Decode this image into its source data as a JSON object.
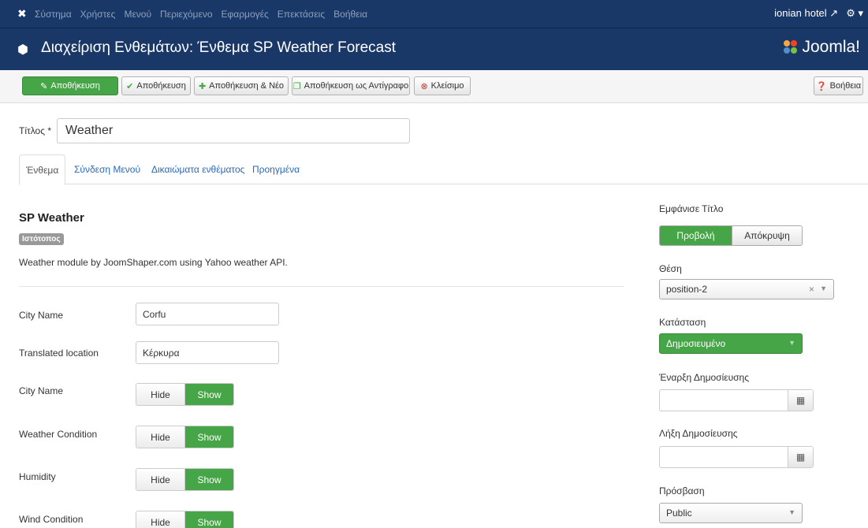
{
  "topnav": {
    "menu": [
      "Σύστημα",
      "Χρήστες",
      "Μενού",
      "Περιεχόμενο",
      "Εφαρμογές",
      "Επεκτάσεις",
      "Βοήθεια"
    ],
    "user": "ionian hotel"
  },
  "header": {
    "title": "Διαχείριση Ενθεμάτων: Ένθεμα SP Weather Forecast",
    "brand": "Joomla!"
  },
  "toolbar": {
    "save": "Αποθήκευση",
    "save_close": "Αποθήκευση",
    "save_new": "Αποθήκευση & Νέο",
    "save_copy": "Αποθήκευση ως Αντίγραφο",
    "close": "Κλείσιμο",
    "help": "Βοήθεια"
  },
  "form": {
    "title_label": "Τίτλος *",
    "title_value": "Weather"
  },
  "tabs": [
    "Ένθεμα",
    "Σύνδεση Μενού",
    "Δικαιώματα ενθέματος",
    "Προηγμένα"
  ],
  "module": {
    "name": "SP Weather",
    "badge": "Ιστότοπος",
    "description": "Weather module by JoomShaper.com using Yahoo weather API."
  },
  "fields": {
    "city_name_label": "City Name",
    "city_name_value": "Corfu",
    "translated_label": "Translated location",
    "translated_value": "Κέρκυρα"
  },
  "toggles": [
    {
      "label": "City Name",
      "off": "Hide",
      "on": "Show"
    },
    {
      "label": "Weather Condition",
      "off": "Hide",
      "on": "Show"
    },
    {
      "label": "Humidity",
      "off": "Hide",
      "on": "Show"
    },
    {
      "label": "Wind Condition",
      "off": "Hide",
      "on": "Show"
    }
  ],
  "sidebar": {
    "show_title_label": "Εμφάνισε Τίτλο",
    "show": "Προβολή",
    "hide": "Απόκρυψη",
    "position_label": "Θέση",
    "position_value": "position-2",
    "status_label": "Κατάσταση",
    "status_value": "Δημοσιευμένο",
    "publish_start_label": "Έναρξη Δημοσίευσης",
    "publish_end_label": "Λήξη Δημοσίευσης",
    "access_label": "Πρόσβαση",
    "access_value": "Public"
  },
  "colors": {
    "navy": "#1a3867",
    "green": "#46a546"
  }
}
